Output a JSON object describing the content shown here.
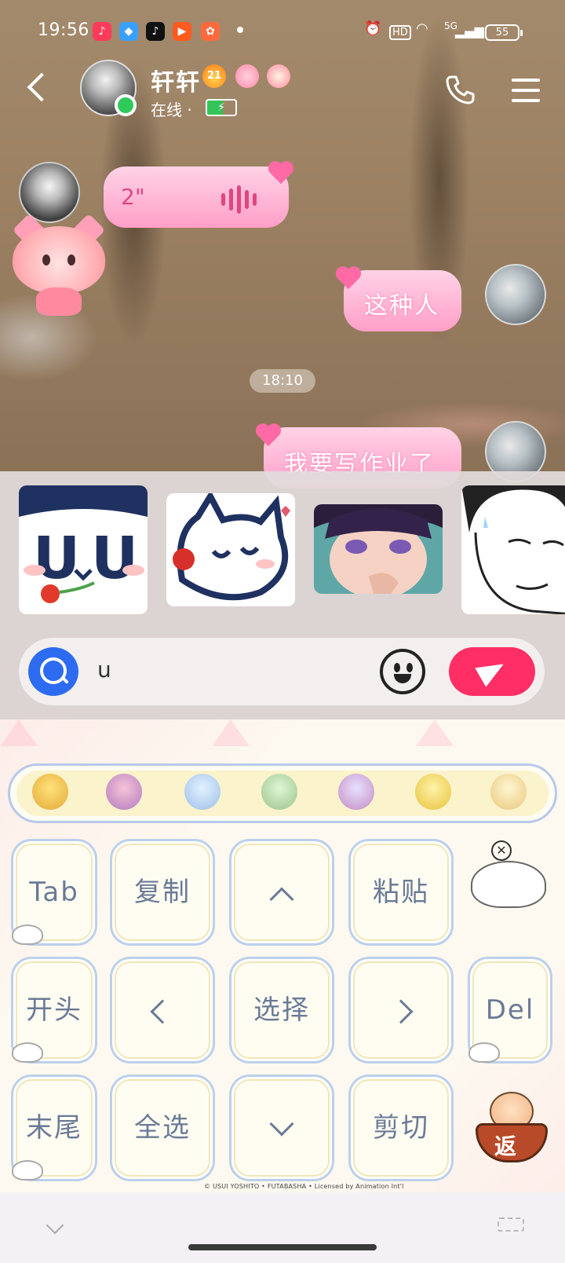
{
  "status_bar": {
    "time": "19:56",
    "hd_label": "HD",
    "network_label": "5G",
    "battery": "55"
  },
  "header": {
    "contact_name": "轩轩",
    "streak_count": "21",
    "status": "在线",
    "separator": "·"
  },
  "messages": [
    {
      "type": "voice",
      "side": "left",
      "duration": "2\""
    },
    {
      "type": "text",
      "side": "right",
      "text": "这种人"
    },
    {
      "type": "timestamp",
      "text": "18:10"
    },
    {
      "type": "text",
      "side": "right",
      "text": "我要写作业了"
    }
  ],
  "sticker_panel": {
    "stickers": [
      "cat-uvu-sticker",
      "cat-rose-sticker",
      "anime-girl-sticker",
      "manga-man-sticker"
    ]
  },
  "input": {
    "value": "u"
  },
  "keyboard": {
    "toolbar_icons": [
      "burger-icon",
      "cake-icon",
      "lightbulb-icon",
      "pen-icon",
      "bow-star-icon",
      "teapot-icon",
      "umbrella-icon"
    ],
    "keys": {
      "tab": "Tab",
      "copy": "复制",
      "paste": "粘贴",
      "home": "开头",
      "select": "选择",
      "delete": "Del",
      "end": "末尾",
      "select_all": "全选",
      "cut": "剪切",
      "return": "返"
    },
    "copyright": "© USUI YOSHITO • FUTABASHA • Licensed by Animation Int'l"
  },
  "colors": {
    "bubble_pink": "#ff9fc7",
    "send_red": "#ff2f65",
    "search_blue": "#2d6cf0",
    "online_green": "#2ecb5a",
    "key_text": "#6a7a96"
  }
}
